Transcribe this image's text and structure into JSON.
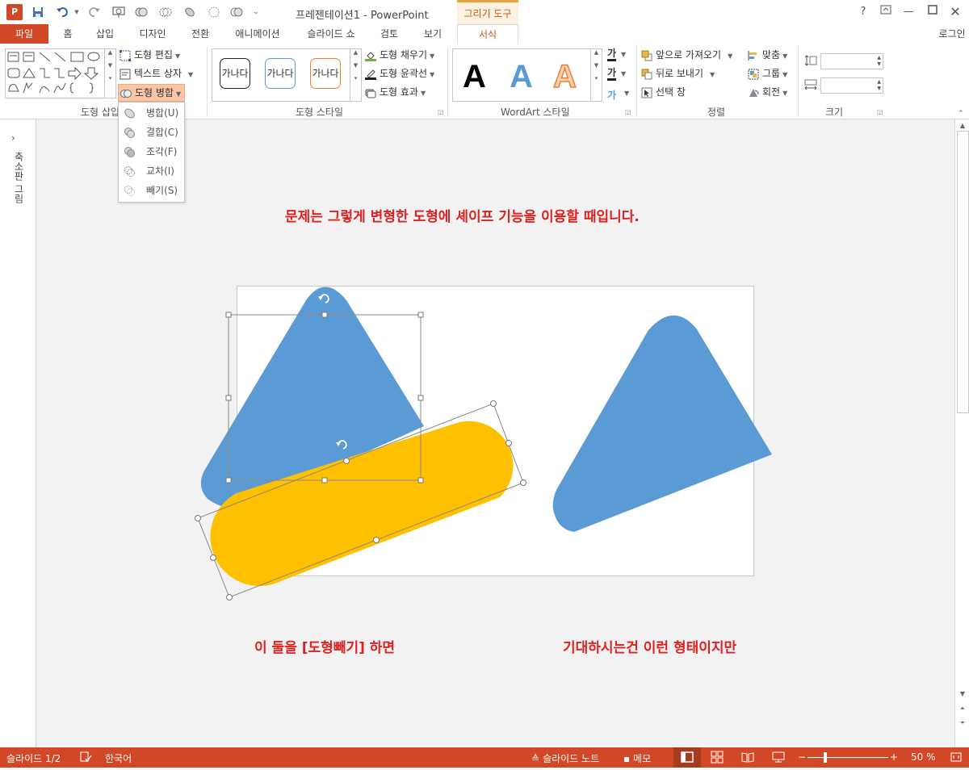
{
  "titlebar": {
    "doc_title": "프레젠테이션1 - PowerPoint",
    "context_tab": "그리기 도구",
    "help": "?",
    "signin": "로그인"
  },
  "tabs": {
    "file": "파일",
    "home": "홈",
    "insert": "삽입",
    "design": "디자인",
    "transitions": "전환",
    "animations": "애니메이션",
    "slideshow": "슬라이드 쇼",
    "review": "검토",
    "view": "보기",
    "format": "서식"
  },
  "ribbon": {
    "insert_shapes": {
      "label": "도형 삽입",
      "edit_shape": "도형 편집",
      "text_box": "텍스트 상자",
      "merge_shapes": "도형 병합"
    },
    "shape_styles": {
      "label": "도형 스타일",
      "sample_text": "가나다",
      "fill": "도형 채우기",
      "outline": "도형 윤곽선",
      "effects": "도형 효과"
    },
    "wordart": {
      "label": "WordArt 스타일",
      "letter": "A",
      "text_fill_glyph": "가",
      "text_outline_glyph": "가"
    },
    "arrange": {
      "label": "정렬",
      "bring_forward": "앞으로 가져오기",
      "send_backward": "뒤로 보내기",
      "selection_pane": "선택 창",
      "align": "맞춤",
      "group": "그룹",
      "rotate": "회전"
    },
    "size": {
      "label": "크기",
      "height_value": "",
      "width_value": ""
    }
  },
  "merge_menu": {
    "items": [
      "병합(U)",
      "결합(C)",
      "조각(F)",
      "교차(I)",
      "빼기(S)"
    ]
  },
  "thumbnail_pane": {
    "label": "축소판 그림"
  },
  "slide": {
    "top_text": "문제는 그렇게 변형한 도형에 셰이프 기능을 이용할 때입니다.",
    "left_caption": "이 둘을 [도형빼기] 하면",
    "right_caption": "기대하시는건 이런 형태이지만",
    "colors": {
      "triangle": "#5b9bd5",
      "capsule": "#ffc000",
      "caption": "#e02020"
    }
  },
  "statusbar": {
    "slide_pos": "슬라이드 1/2",
    "language": "한국어",
    "notes": "슬라이드 노트",
    "comments": "메모",
    "zoom": "50 %",
    "zoom_out": "−",
    "zoom_in": "+"
  },
  "colors": {
    "accent": "#d24726",
    "context": "#c55a11"
  }
}
